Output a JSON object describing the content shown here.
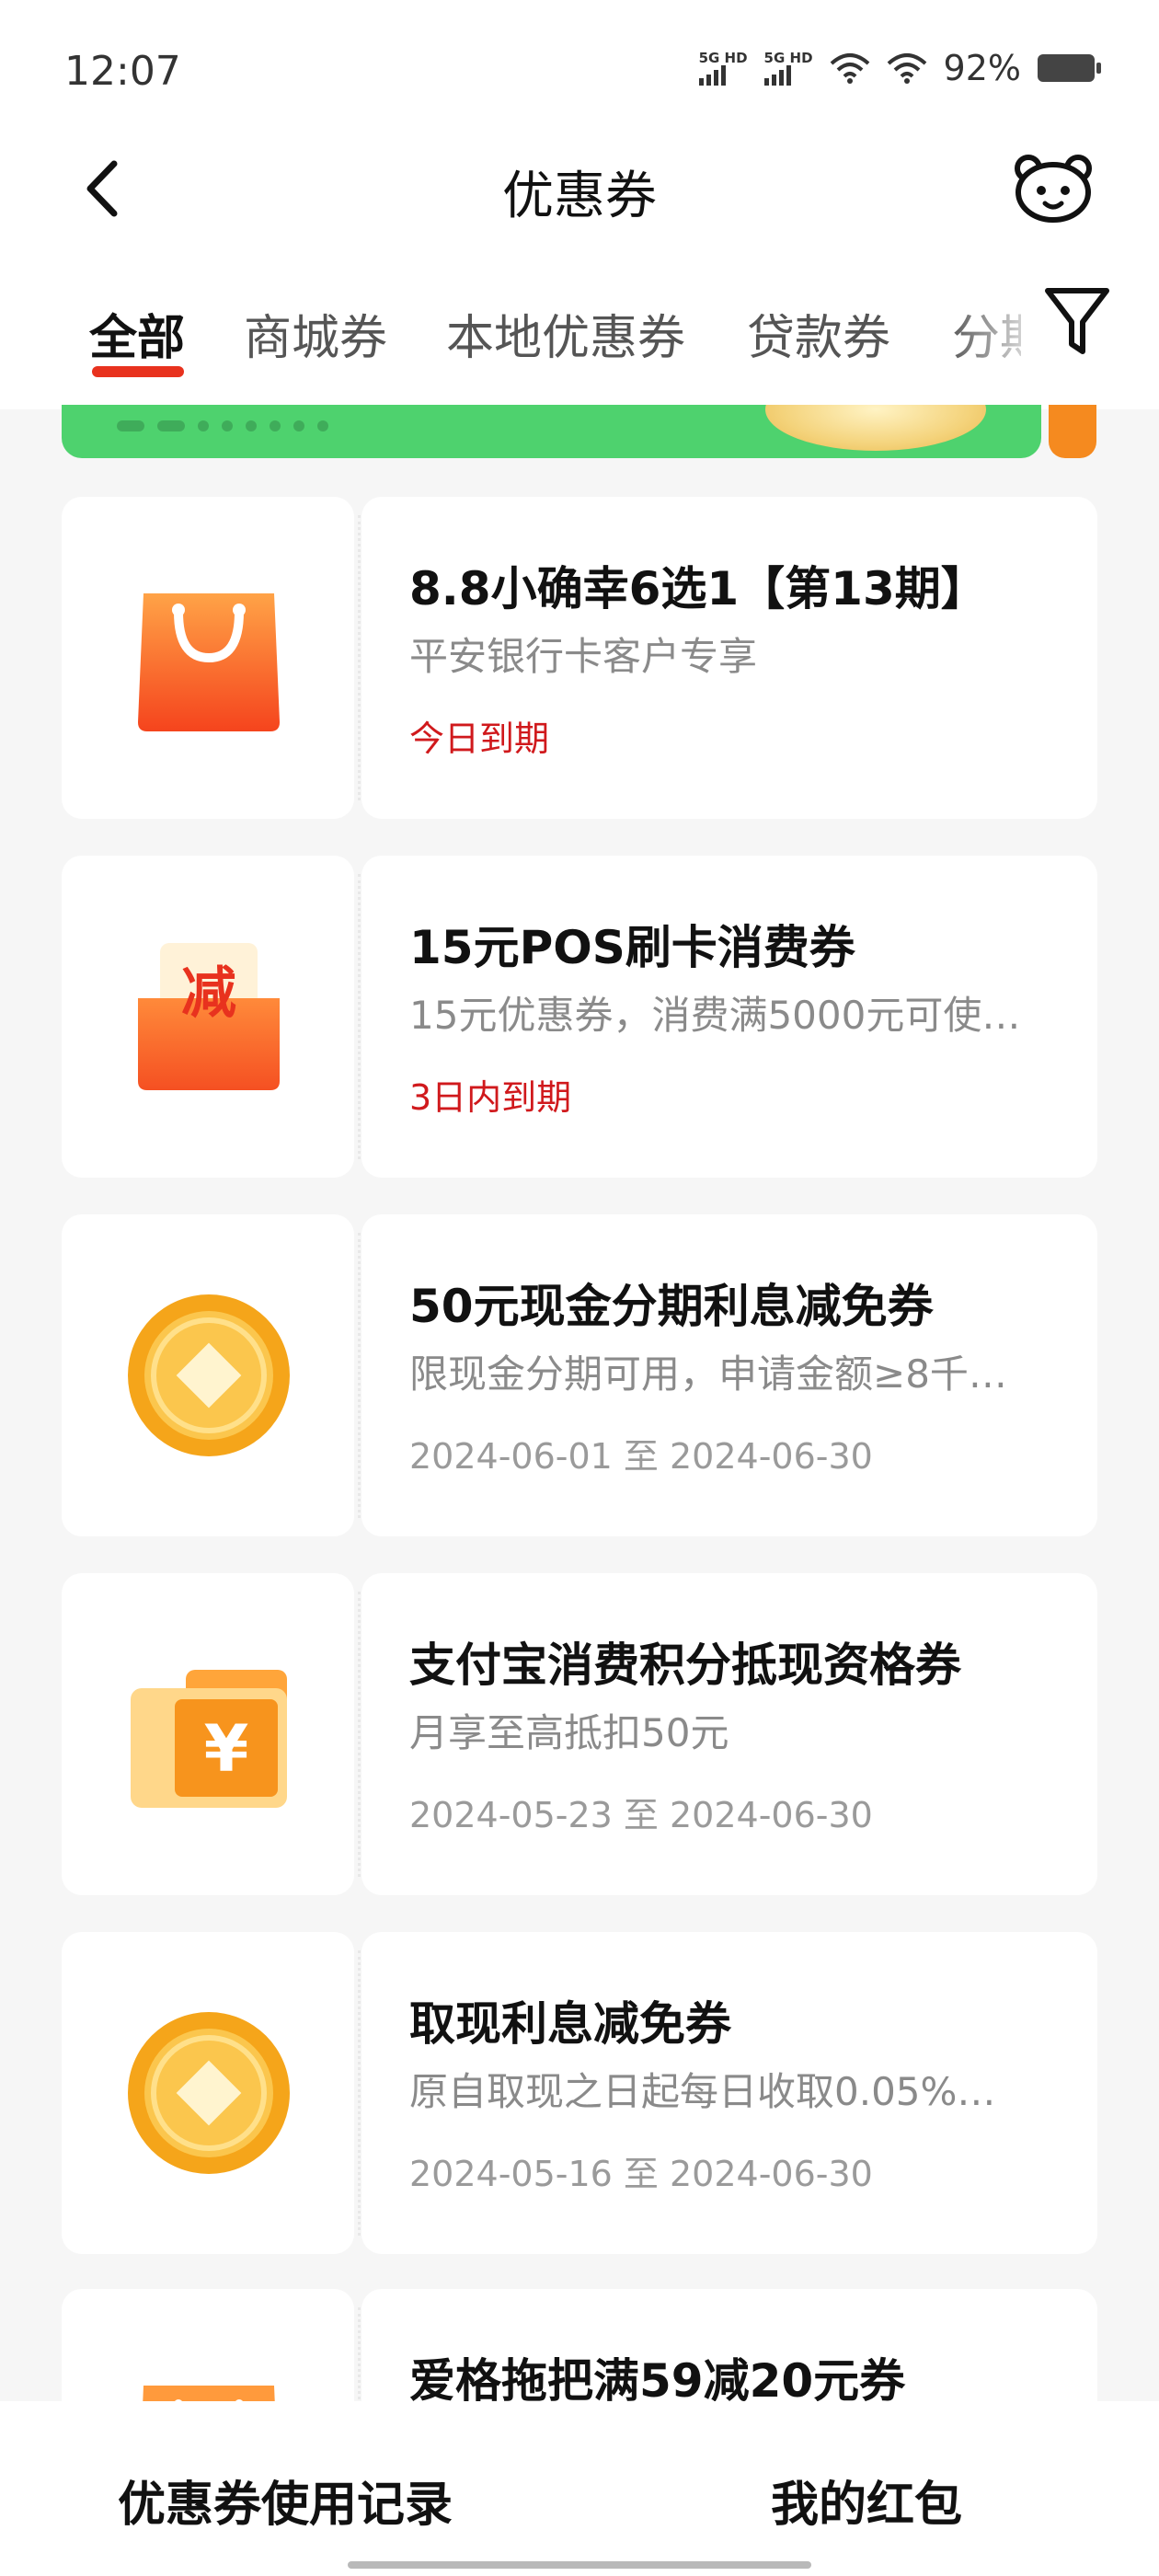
{
  "status_bar": {
    "time": "12:07",
    "signal_1": "5G HD",
    "signal_2": "5G HD",
    "battery": "92%"
  },
  "nav": {
    "title": "优惠券",
    "back_icon": "chevron-left-icon",
    "service_icon": "customer-service-bear-icon"
  },
  "tabs": [
    {
      "label": "全部",
      "active": true
    },
    {
      "label": "商城券",
      "active": false
    },
    {
      "label": "本地优惠券",
      "active": false
    },
    {
      "label": "贷款券",
      "active": false
    },
    {
      "label": "分期",
      "active": false
    }
  ],
  "filter_icon": "filter-funnel-icon",
  "colors": {
    "accent": "#e8321e",
    "expiry_red": "#d0191c",
    "banner_green": "#4ed26e",
    "coin_orange": "#f5a51a"
  },
  "coupons": [
    {
      "icon": "shopping-bag-icon",
      "title": "8.8小确幸6选1【第13期】",
      "desc": "平安银行卡客户专享",
      "expiry": "今日到期"
    },
    {
      "icon": "discount-envelope-icon",
      "icon_text": "减",
      "title": "15元POS刷卡消费券",
      "desc": "15元优惠券，消费满5000元可使…",
      "expiry": "3日内到期"
    },
    {
      "icon": "gold-coin-icon",
      "title": "50元现金分期利息减免券",
      "desc": "限现金分期可用，申请金额≥8千…",
      "date": "2024-06-01 至 2024-06-30"
    },
    {
      "icon": "yuan-ticket-icon",
      "icon_text": "¥",
      "title": "支付宝消费积分抵现资格券",
      "desc": "月享至高抵扣50元",
      "date": "2024-05-23 至 2024-06-30"
    },
    {
      "icon": "gold-coin-icon",
      "title": "取现利息减免券",
      "desc": "原自取现之日起每日收取0.05%…",
      "date": "2024-05-16 至 2024-06-30"
    },
    {
      "icon": "shopping-bag-icon",
      "title": "爱格拖把满59减20元券",
      "desc": "",
      "date": ""
    }
  ],
  "bottom": {
    "records_label": "优惠券使用记录",
    "red_packet_label": "我的红包"
  }
}
